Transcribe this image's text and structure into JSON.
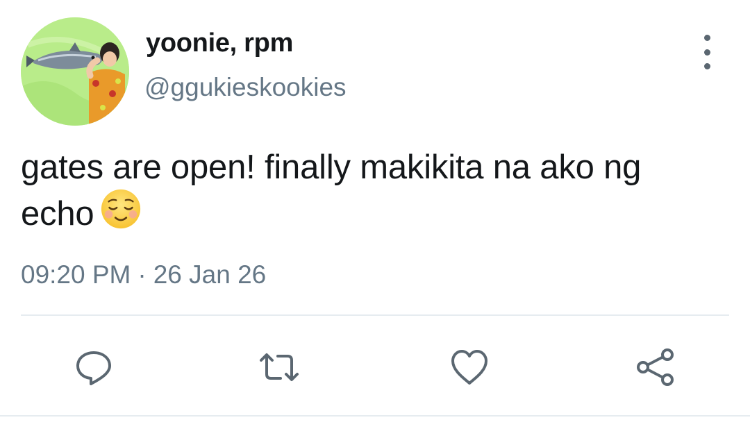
{
  "user": {
    "display_name": "yoonie, rpm",
    "handle": "@ggukieskookies",
    "avatar_icon": "avatar-person-holding-fish"
  },
  "tweet": {
    "text": "gates are open! finally makikita na ako ng echo",
    "emoji": "relieved-face-emoji"
  },
  "meta": {
    "time": "09:20 PM",
    "separator": "·",
    "date": "26 Jan 26"
  },
  "actions": {
    "reply_icon": "reply-icon",
    "retweet_icon": "retweet-icon",
    "like_icon": "heart-icon",
    "share_icon": "share-icon",
    "more_icon": "more-vertical-icon"
  },
  "colors": {
    "text": "#14171a",
    "secondary": "#657786",
    "icon": "#5b6771",
    "divider": "#e6ecf0",
    "avatar_bg": "#b9ec8a"
  }
}
